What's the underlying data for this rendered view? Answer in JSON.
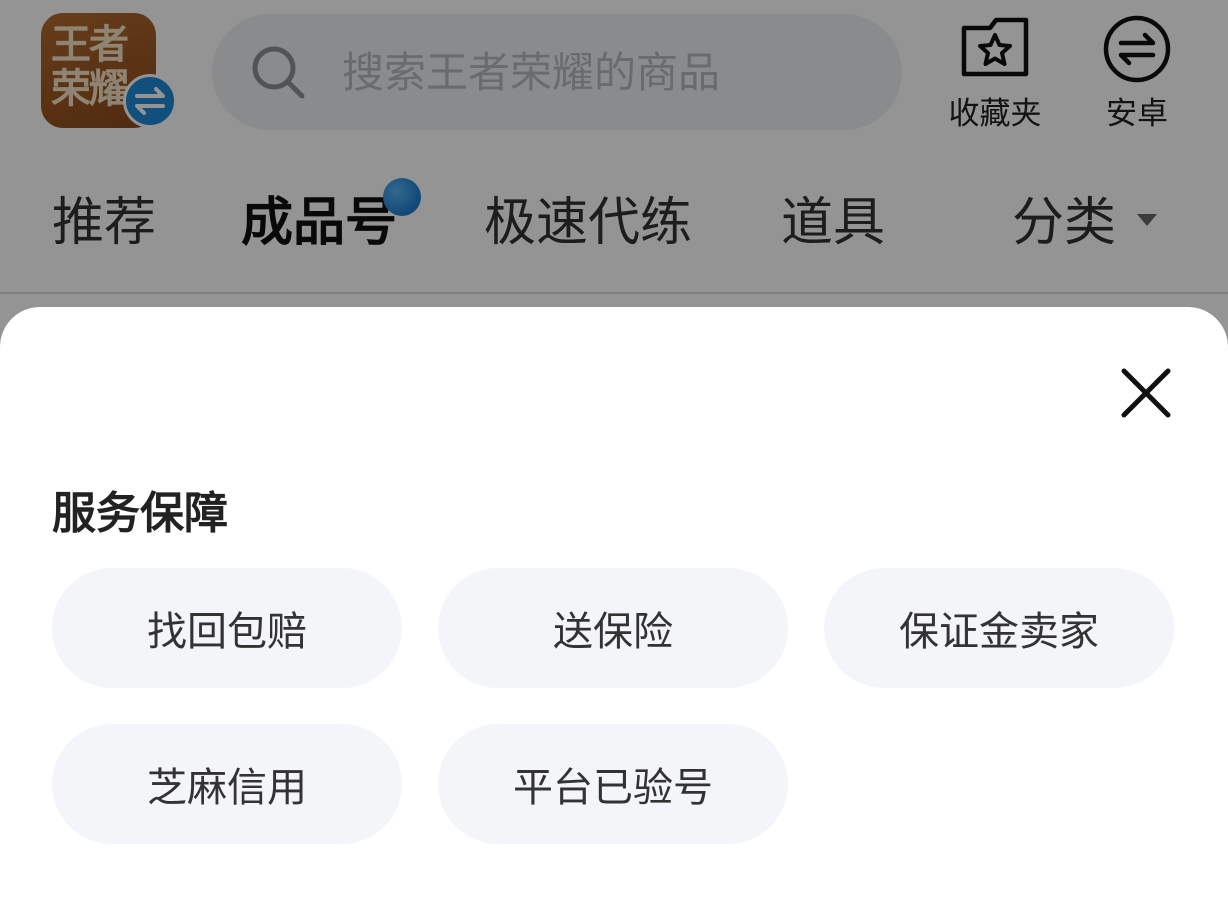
{
  "header": {
    "logo_text": "王者荣耀",
    "logo_icon": "game-logo",
    "switch_icon": "switch-arrows-icon",
    "search": {
      "placeholder": "搜索王者荣耀的商品",
      "value": "",
      "icon": "search-icon"
    },
    "actions": [
      {
        "label": "收藏夹",
        "icon": "favorites-star-folder-icon"
      },
      {
        "label": "安卓",
        "icon": "android-switch-icon"
      }
    ]
  },
  "tabs": [
    {
      "label": "推荐",
      "active": false
    },
    {
      "label": "成品号",
      "active": true,
      "badge_dot": true
    },
    {
      "label": "极速代练",
      "active": false
    },
    {
      "label": "道具",
      "active": false
    },
    {
      "label": "分类",
      "active": false,
      "dropdown": true
    }
  ],
  "sheet": {
    "title": "服务保障",
    "close_icon": "close-icon",
    "options": [
      {
        "label": "找回包赔"
      },
      {
        "label": "送保险"
      },
      {
        "label": "保证金卖家"
      },
      {
        "label": "芝麻信用"
      },
      {
        "label": "平台已验号"
      }
    ]
  },
  "colors": {
    "overlay": "rgba(0,0,0,0.42)",
    "option_bg": "#f4f5f8",
    "badge_blue": "#1e88d8",
    "search_bg": "#eef0f3"
  }
}
